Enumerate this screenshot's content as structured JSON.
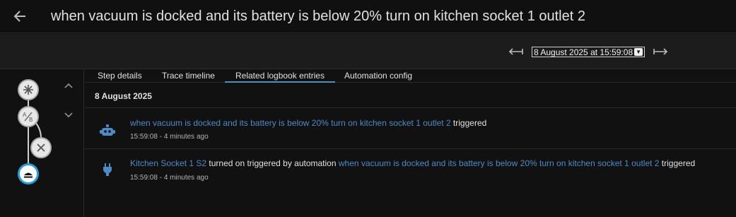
{
  "header": {
    "title": "when vacuum is docked and its battery is below 20% turn on kitchen socket 1 outlet 2"
  },
  "toolbar": {
    "trace_selected": "8 August 2025 at 15:59:08"
  },
  "tabs": [
    {
      "label": "Step details"
    },
    {
      "label": "Trace timeline"
    },
    {
      "label": "Related logbook entries"
    },
    {
      "label": "Automation config"
    }
  ],
  "logbook": {
    "date": "8 August 2025",
    "entries": [
      {
        "icon": "robot-icon",
        "link1": "when vacuum is docked and its battery is below 20% turn on kitchen socket 1 outlet 2",
        "text1": " triggered",
        "meta": "15:59:08 - 4 minutes ago"
      },
      {
        "icon": "power-plug-icon",
        "link1": "Kitchen Socket 1 S2",
        "text1": " turned on triggered by automation ",
        "link2": "when vacuum is docked and its battery is below 20% turn on kitchen socket 1 outlet 2",
        "text2": " triggered",
        "meta": "15:59:08 - 4 minutes ago"
      }
    ]
  },
  "graph": {
    "nodes": [
      "trigger-icon",
      "condition-icon",
      "not-executed-icon",
      "action-icon"
    ]
  },
  "colors": {
    "link": "#4e8ac4",
    "accent": "#2a9bd6",
    "background": "#111111"
  }
}
